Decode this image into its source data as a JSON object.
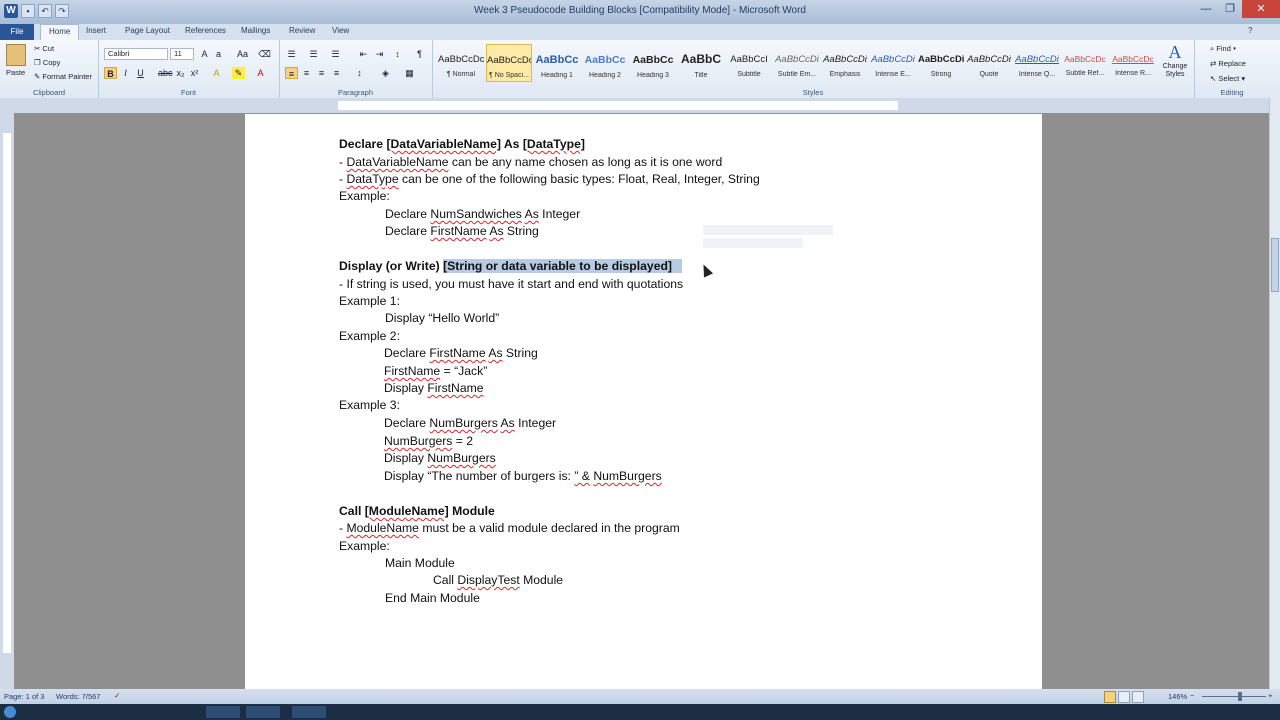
{
  "window": {
    "title": "Week 3 Pseudocode Building Blocks [Compatibility Mode] - Microsoft Word"
  },
  "tabs": [
    "File",
    "Home",
    "Insert",
    "Page Layout",
    "References",
    "Mailings",
    "Review",
    "View"
  ],
  "ribbon": {
    "clipboard": {
      "paste": "Paste",
      "cut": "Cut",
      "copy": "Copy",
      "format_painter": "Format Painter",
      "label": "Clipboard"
    },
    "font": {
      "name": "Calibri",
      "size": "11",
      "label": "Font"
    },
    "paragraph": {
      "label": "Paragraph"
    },
    "styles": {
      "label": "Styles",
      "items": [
        {
          "preview": "AaBbCcDc",
          "name": "¶ Normal"
        },
        {
          "preview": "AaBbCcDc",
          "name": "¶ No Spaci..."
        },
        {
          "preview": "AaBbCc",
          "name": "Heading 1"
        },
        {
          "preview": "AaBbCc",
          "name": "Heading 2"
        },
        {
          "preview": "AaBbCc",
          "name": "Heading 3"
        },
        {
          "preview": "AaBbC",
          "name": "Title"
        },
        {
          "preview": "AaBbCcI",
          "name": "Subtitle"
        },
        {
          "preview": "AaBbCcDi",
          "name": "Subtle Em..."
        },
        {
          "preview": "AaBbCcDi",
          "name": "Emphasis"
        },
        {
          "preview": "AaBbCcDi",
          "name": "Intense E..."
        },
        {
          "preview": "AaBbCcDi",
          "name": "Strong"
        },
        {
          "preview": "AaBbCcDi",
          "name": "Quote"
        },
        {
          "preview": "AaBbCcDi",
          "name": "Intense Q..."
        },
        {
          "preview": "AaBbCcDc",
          "name": "Subtle Ref..."
        },
        {
          "preview": "AaBbCcDc",
          "name": "Intense R..."
        }
      ],
      "change_styles": "Change Styles"
    },
    "editing": {
      "find": "Find",
      "replace": "Replace",
      "select": "Select",
      "label": "Editing"
    }
  },
  "document": {
    "s1": {
      "heading_a": "Declare ",
      "heading_b": "[DataVariableName]",
      "heading_c": "  As ",
      "heading_d": "[DataType]",
      "l1_a": "- ",
      "l1_b": "DataVariableName",
      "l1_c": "  can be any name chosen as long as it is one word",
      "l2_a": "- ",
      "l2_b": "DataType",
      "l2_c": " can be one of the following basic types: Float, Real, Integer, String",
      "example": "Example:",
      "e1_a": "Declare ",
      "e1_b": "NumSandwiches",
      "e1_c": " ",
      "e1_d": "As",
      "e1_e": " Integer",
      "e2_a": "Declare ",
      "e2_b": "FirstName",
      "e2_c": " ",
      "e2_d": "As",
      "e2_e": " String"
    },
    "s2": {
      "heading_a": "Display (or Write) ",
      "heading_b": "[String or data variable to be displayed]",
      "l1": "- If string is used, you must have it start and end with quotations",
      "ex1": "Example 1:",
      "ex1_l1": "Display “Hello World”",
      "ex2": "Example 2:",
      "ex2_l1_a": "Declare ",
      "ex2_l1_b": "FirstName",
      "ex2_l1_c": " ",
      "ex2_l1_d": "As",
      "ex2_l1_e": " String",
      "ex2_l2_a": "FirstName",
      "ex2_l2_b": " = “Jack”",
      "ex2_l3_a": "Display ",
      "ex2_l3_b": "FirstName",
      "ex3": "Example 3:",
      "ex3_l1_a": "Declare ",
      "ex3_l1_b": "NumBurgers",
      "ex3_l1_c": " ",
      "ex3_l1_d": "As",
      "ex3_l1_e": " Integer",
      "ex3_l2_a": "NumBurgers",
      "ex3_l2_b": " = 2",
      "ex3_l3_a": "Display ",
      "ex3_l3_b": "NumBurgers",
      "ex3_l4_a": "Display “The number of burgers is: ",
      "ex3_l4_b": "” &",
      "ex3_l4_c": " ",
      "ex3_l4_d": "NumBurgers"
    },
    "s3": {
      "heading_a": "Call ",
      "heading_b": "[ModuleName]",
      "heading_c": "  Module",
      "l1_a": "- ",
      "l1_b": "ModuleName",
      "l1_c": "  must be a valid module declared  in the program",
      "example": "Example:",
      "e1": "Main Module",
      "e2_a": "Call ",
      "e2_b": "DisplayTest",
      "e2_c": " Module",
      "e3": "End Main Module"
    }
  },
  "status": {
    "page": "Page: 1 of 3",
    "words": "Words: 7/567",
    "zoom": "146%"
  }
}
